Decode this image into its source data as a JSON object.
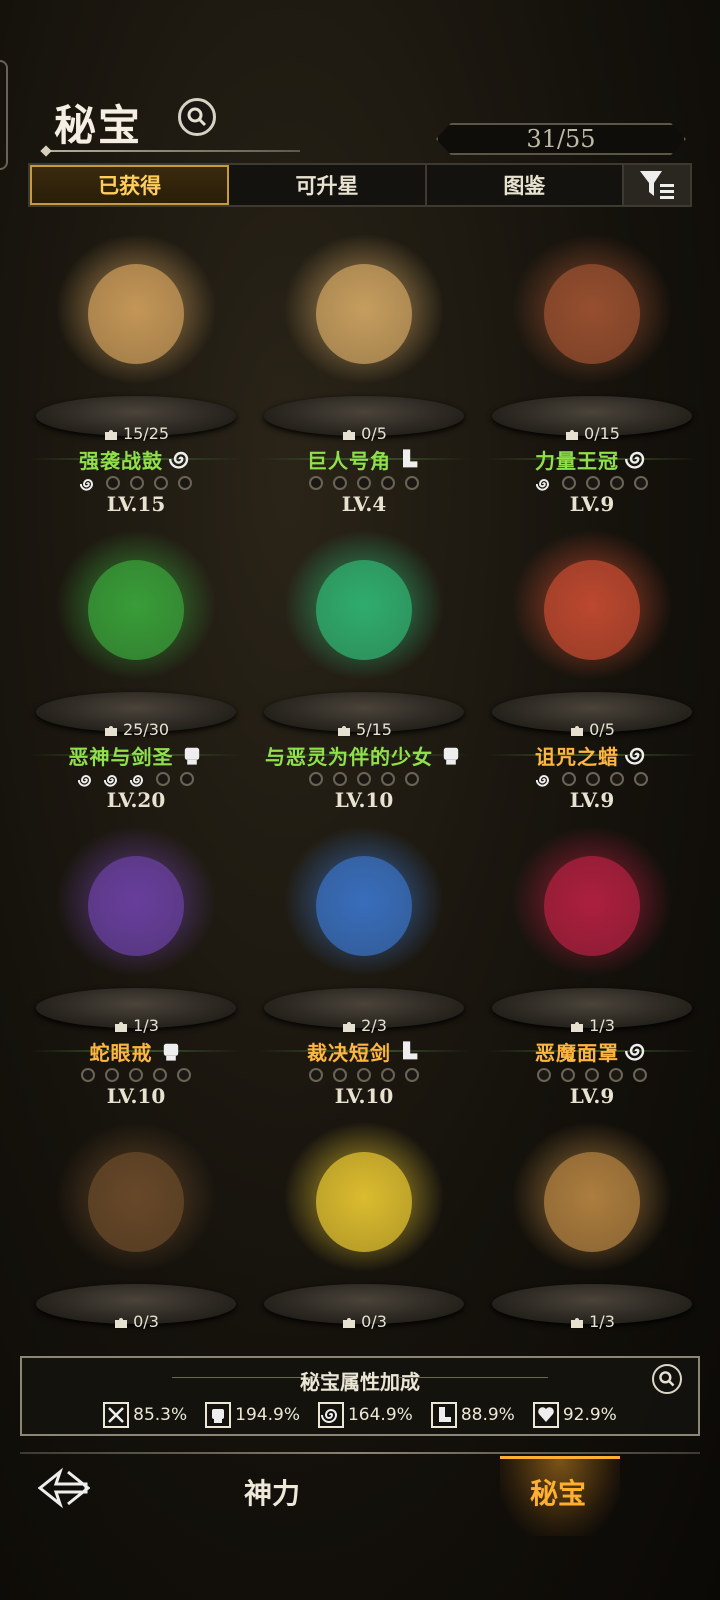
{
  "header": {
    "title": "秘宝",
    "count": "31/55"
  },
  "tabs": [
    {
      "label": "已获得",
      "active": true
    },
    {
      "label": "可升星",
      "active": false
    },
    {
      "label": "图鉴",
      "active": false
    }
  ],
  "items": [
    {
      "name": "强袭战鼓",
      "fragments": "15/25",
      "level": "LV.15",
      "color": "green",
      "icon": "drums-icon",
      "type_icon": "spiral-icon",
      "stars_filled": 1
    },
    {
      "name": "巨人号角",
      "fragments": "0/5",
      "level": "LV.4",
      "color": "green",
      "icon": "horn-icon",
      "type_icon": "boot-icon",
      "stars_filled": 0
    },
    {
      "name": "力量王冠",
      "fragments": "0/15",
      "level": "LV.9",
      "color": "green",
      "icon": "crown-icon",
      "type_icon": "spiral-icon",
      "stars_filled": 1
    },
    {
      "name": "恶神与剑圣",
      "fragments": "25/30",
      "level": "LV.20",
      "color": "green",
      "icon": "demon-swordsman-icon",
      "type_icon": "fist-icon",
      "stars_filled": 3
    },
    {
      "name": "与恶灵为伴的少女",
      "fragments": "5/15",
      "level": "LV.10",
      "color": "green",
      "icon": "spirit-girl-icon",
      "type_icon": "fist-icon",
      "stars_filled": 0
    },
    {
      "name": "诅咒之蜡",
      "fragments": "0/5",
      "level": "LV.9",
      "color": "gold",
      "icon": "candle-icon",
      "type_icon": "spiral-icon",
      "stars_filled": 1
    },
    {
      "name": "蛇眼戒",
      "fragments": "1/3",
      "level": "LV.10",
      "color": "gold",
      "icon": "ring-icon",
      "type_icon": "fist-icon",
      "stars_filled": 0
    },
    {
      "name": "裁决短剑",
      "fragments": "2/3",
      "level": "LV.10",
      "color": "gold",
      "icon": "dagger-icon",
      "type_icon": "boot-icon",
      "stars_filled": 0
    },
    {
      "name": "恶魔面罩",
      "fragments": "1/3",
      "level": "LV.9",
      "color": "gold",
      "icon": "mask-icon",
      "type_icon": "spiral-icon",
      "stars_filled": 0
    },
    {
      "name": "",
      "fragments": "0/3",
      "level": "",
      "color": "gold",
      "icon": "bag-icon",
      "type_icon": "",
      "stars_filled": 0
    },
    {
      "name": "",
      "fragments": "0/3",
      "level": "",
      "color": "gold",
      "icon": "lotus-icon",
      "type_icon": "",
      "stars_filled": 0
    },
    {
      "name": "",
      "fragments": "1/3",
      "level": "",
      "color": "gold",
      "icon": "pipe-icon",
      "type_icon": "",
      "stars_filled": 0
    }
  ],
  "bonus": {
    "title": "秘宝属性加成",
    "stats": [
      {
        "icon": "sword-icon",
        "value": "85.3%"
      },
      {
        "icon": "fist-icon",
        "value": "194.9%"
      },
      {
        "icon": "spiral-icon",
        "value": "164.9%"
      },
      {
        "icon": "boot-icon",
        "value": "88.9%"
      },
      {
        "icon": "heart-icon",
        "value": "92.9%"
      }
    ]
  },
  "nav": {
    "power": "神力",
    "treasure": "秘宝"
  },
  "colors": {
    "green": "#8fe04a",
    "gold": "#ffb640",
    "accent": "#ffb02e"
  }
}
